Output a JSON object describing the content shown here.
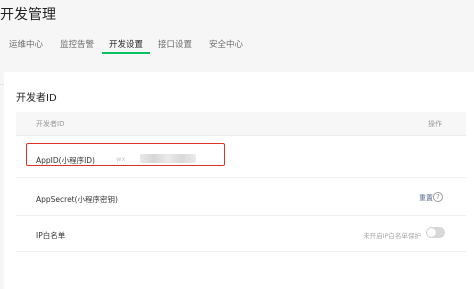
{
  "page": {
    "title": "开发管理"
  },
  "tabs": [
    {
      "label": "运维中心"
    },
    {
      "label": "监控告警"
    },
    {
      "label": "开发设置"
    },
    {
      "label": "接口设置"
    },
    {
      "label": "安全中心"
    }
  ],
  "developer_id": {
    "title": "开发者ID",
    "table": {
      "header_name": "开发者ID",
      "header_action": "操作"
    },
    "appid": {
      "label": "AppID(小程序ID)",
      "value_prefix": "wx",
      "value_suffix": "a5",
      "value_masked": true
    },
    "appsecret": {
      "label": "AppSecret(小程序密钥)",
      "action_label": "重置",
      "help_icon": "question-circle-icon"
    },
    "ip_whitelist": {
      "label": "IP白名单",
      "status_text": "未开启IP白名单保护",
      "toggle_on": false
    }
  },
  "colors": {
    "active_tab_underline": "#07c160",
    "link": "#576b95",
    "highlight_border": "#d9332b"
  }
}
